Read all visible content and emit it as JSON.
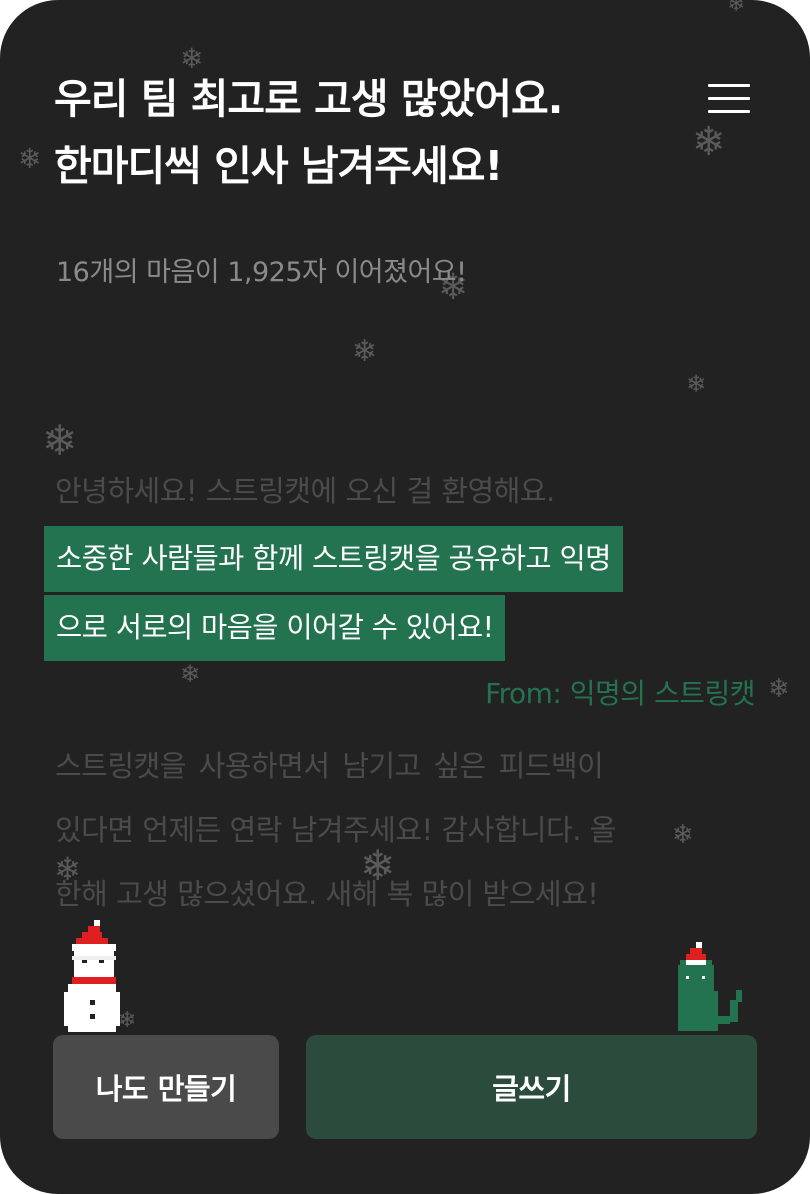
{
  "header": {
    "title_line1": "우리 팀 최고로 고생 많았어요.",
    "title_line2": "한마디씩 인사 남겨주세요!",
    "menu_icon": "hamburger-menu-icon"
  },
  "stats_text": "16개의 마음이 1,925자 이어졌어요!",
  "messages": {
    "welcome_line": "안녕하세요! 스트링캣에 오신 걸 환영해요.",
    "highlight_line1": "소중한 사람들과 함께 스트링캣을 공유하고 익명",
    "highlight_line2": "으로 서로의 마음을 이어갈 수 있어요!",
    "from_label": "From: 익명의 스트링캣",
    "feedback_line1": "스트링캣을  사용하면서  남기고  싶은  피드백이",
    "feedback_line2": "있다면 언제든 연락 남겨주세요! 감사합니다. 올",
    "feedback_line3": "한해 고생 많으셨어요. 새해 복 많이 받으세요!"
  },
  "buttons": {
    "make_label": "나도 만들기",
    "write_label": "글쓰기"
  },
  "decorations": {
    "snowflake_glyph": "❄",
    "snowman_icon": "snowman-icon",
    "cat_icon": "santa-cat-icon"
  },
  "colors": {
    "background": "#222222",
    "accent_green": "#247350",
    "write_button": "#2b4b3c",
    "make_button": "#4a4a4a",
    "dim_text": "#4b4b4b",
    "stats_text": "#8a8a8a"
  }
}
